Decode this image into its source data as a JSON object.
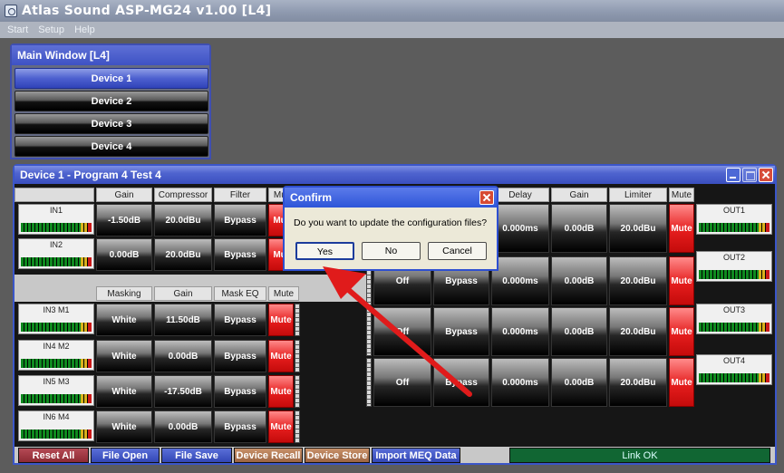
{
  "app": {
    "title": "Atlas Sound   ASP-MG24 v1.00   [L4]"
  },
  "menu": [
    "Start",
    "Setup",
    "Help"
  ],
  "main_window": {
    "title": "Main Window [L4]",
    "devices": [
      "Device 1",
      "Device 2",
      "Device 3",
      "Device 4"
    ],
    "selected": "Device 1"
  },
  "device_window": {
    "title": "Device 1  -  Program 4   Test 4",
    "inputs_header": [
      "Gain",
      "Compressor",
      "Filter",
      "Mute"
    ],
    "inputs": [
      {
        "label": "IN1",
        "gain": "-1.50dB",
        "compressor": "20.0dBu",
        "filter": "Bypass",
        "mute": "Mute"
      },
      {
        "label": "IN2",
        "gain": "0.00dB",
        "compressor": "20.0dBu",
        "filter": "Bypass",
        "mute": "Mute"
      }
    ],
    "mics_header": [
      "Masking",
      "Gain",
      "Mask EQ",
      "Mute"
    ],
    "mics": [
      {
        "label": "IN3 M1",
        "masking": "White",
        "gain": "11.50dB",
        "mask_eq": "Bypass",
        "mute": "Mute"
      },
      {
        "label": "IN4 M2",
        "masking": "White",
        "gain": "0.00dB",
        "mask_eq": "Bypass",
        "mute": "Mute"
      },
      {
        "label": "IN5 M3",
        "masking": "White",
        "gain": "-17.50dB",
        "mask_eq": "Bypass",
        "mute": "Mute"
      },
      {
        "label": "IN6 M4",
        "masking": "White",
        "gain": "0.00dB",
        "mask_eq": "Bypass",
        "mute": "Mute"
      }
    ],
    "outputs_header": [
      "Delay",
      "Gain",
      "Limiter",
      "Mute"
    ],
    "outputs": [
      {
        "label": "OUT1",
        "a": "",
        "b": "",
        "delay": "0.000ms",
        "gain": "0.00dB",
        "limiter": "20.0dBu",
        "mute": "Mute"
      },
      {
        "label": "OUT2",
        "a": "Off",
        "b": "Bypass",
        "delay": "0.000ms",
        "gain": "0.00dB",
        "limiter": "20.0dBu",
        "mute": "Mute"
      },
      {
        "label": "OUT3",
        "a": "Off",
        "b": "Bypass",
        "delay": "0.000ms",
        "gain": "0.00dB",
        "limiter": "20.0dBu",
        "mute": "Mute"
      },
      {
        "label": "OUT4",
        "a": "Off",
        "b": "Bypass",
        "delay": "0.000ms",
        "gain": "0.00dB",
        "limiter": "20.0dBu",
        "mute": "Mute"
      }
    ],
    "bottom_buttons": [
      "Reset All",
      "File Open",
      "File Save",
      "Device Recall",
      "Device Store",
      "Import MEQ Data"
    ],
    "status": "Link OK"
  },
  "dialog": {
    "title": "Confirm",
    "message": "Do you want to update the configuration files?",
    "buttons": [
      "Yes",
      "No",
      "Cancel"
    ]
  },
  "colors": {
    "accent_blue": "#3e52c4",
    "mute_red": "#e51d1d",
    "link_green": "#116633",
    "arrow_red": "#e01b1b"
  }
}
